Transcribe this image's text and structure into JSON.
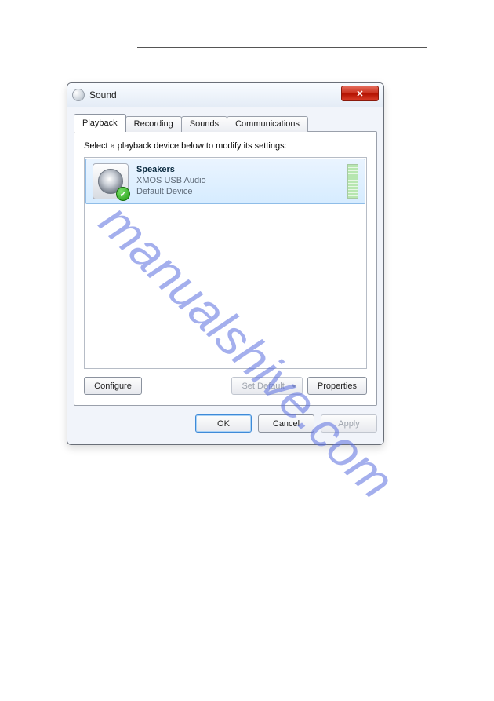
{
  "watermark": "manualshive.com",
  "dialog": {
    "title": "Sound",
    "close_glyph": "✕",
    "tabs": [
      {
        "label": "Playback",
        "active": true
      },
      {
        "label": "Recording",
        "active": false
      },
      {
        "label": "Sounds",
        "active": false
      },
      {
        "label": "Communications",
        "active": false
      }
    ],
    "instruction": "Select a playback device below to modify its settings:",
    "device": {
      "name": "Speakers",
      "driver": "XMOS USB Audio",
      "status": "Default Device",
      "check_glyph": "✓"
    },
    "panel_buttons": {
      "configure": "Configure",
      "set_default": "Set Default",
      "properties": "Properties"
    },
    "dialog_buttons": {
      "ok": "OK",
      "cancel": "Cancel",
      "apply": "Apply"
    }
  }
}
